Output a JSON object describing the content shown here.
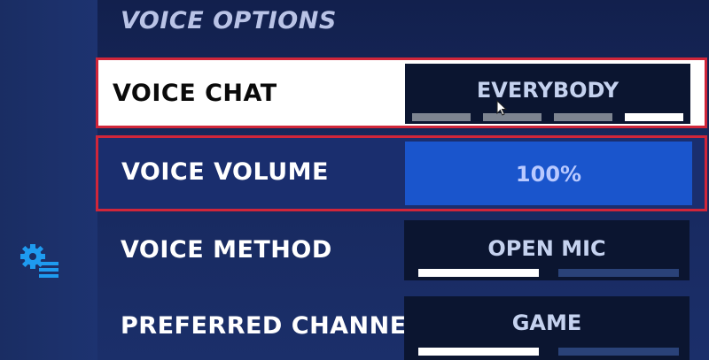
{
  "section_title": "VOICE OPTIONS",
  "rows": [
    {
      "label": "VOICE CHAT",
      "value": "EVERYBODY",
      "options_count": 4,
      "selected_index": 3
    },
    {
      "label": "VOICE VOLUME",
      "value": "100%"
    },
    {
      "label": "VOICE METHOD",
      "value": "OPEN MIC",
      "options_count": 2,
      "selected_index": 0
    },
    {
      "label": "PREFERRED CHANNEL",
      "value": "GAME",
      "options_count": 2,
      "selected_index": 0
    }
  ],
  "colors": {
    "background": "#1b2f68",
    "highlight_border": "#d0263a",
    "volume_fill": "#1a55cc",
    "value_box": "#0b1530"
  },
  "icons": {
    "sidebar": "settings-gear-list-icon"
  }
}
